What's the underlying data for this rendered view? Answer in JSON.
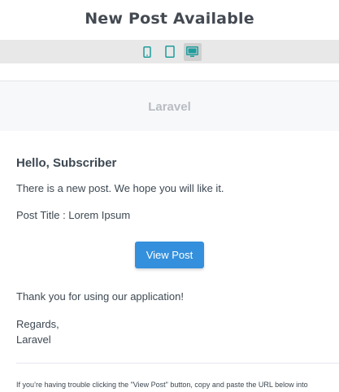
{
  "window": {
    "title": "New Post Available"
  },
  "device_toggle": {
    "items": [
      {
        "name": "mobile",
        "icon": "smartphone-icon",
        "active": false
      },
      {
        "name": "tablet",
        "icon": "tablet-icon",
        "active": false
      },
      {
        "name": "desktop",
        "icon": "desktop-icon",
        "active": true
      }
    ],
    "icon_color": "#1f9c9c"
  },
  "email": {
    "header_brand": "Laravel",
    "greeting": "Hello, Subscriber",
    "intro": "There is a new post. We hope you will like it.",
    "post_title": "Post Title : Lorem Ipsum",
    "action_button": "View Post",
    "outro": "Thank you for using our application!",
    "salutation": "Regards,",
    "signature": "Laravel",
    "subcopy": "If you’re having trouble clicking the \"View Post\" button, copy and paste the URL below into"
  },
  "colors": {
    "button_bg": "#3490dc",
    "header_bg": "#f7f8fa",
    "toolbar_bg": "#e8e8e8",
    "text": "#3d4852"
  }
}
